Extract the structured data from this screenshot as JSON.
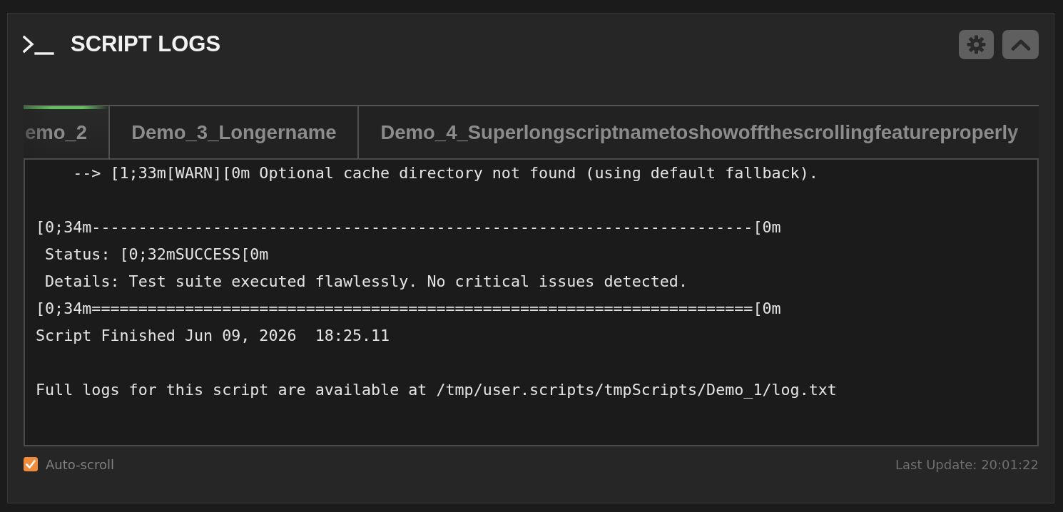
{
  "header": {
    "title": "SCRIPT LOGS",
    "buttons": [
      {
        "kind": "settings"
      },
      {
        "kind": "collapse"
      }
    ]
  },
  "tabs": [
    {
      "label": "emo_2",
      "selected": true
    },
    {
      "label": "Demo_3_Longername",
      "selected": false
    },
    {
      "label": "Demo_4_Superlongscriptnametoshowoffthescrollingfeatureproperly",
      "selected": false
    }
  ],
  "log": {
    "lines": [
      {
        "kind": "text",
        "text": "    --> [1;33m[WARN][0m Optional cache directory not found (using default fallback)."
      },
      {
        "kind": "blank"
      },
      {
        "kind": "text",
        "text": "[0;34m-----------------------------------------------------------------------[0m"
      },
      {
        "kind": "text",
        "text": " Status: [0;32mSUCCESS[0m"
      },
      {
        "kind": "text",
        "text": " Details: Test suite executed flawlessly. No critical issues detected."
      },
      {
        "kind": "text",
        "text": "[0;34m=======================================================================[0m"
      },
      {
        "kind": "text",
        "text": "Script Finished Jun 09, 2026  18:25.11"
      },
      {
        "kind": "blank"
      },
      {
        "kind": "text",
        "text": "Full logs for this script are available at /tmp/user.scripts/tmpScripts/Demo_1/log.txt"
      }
    ]
  },
  "footer": {
    "auto_scroll": {
      "label": "Auto-scroll",
      "checked": true
    },
    "last_update": "Last Update: 20:01:22"
  }
}
